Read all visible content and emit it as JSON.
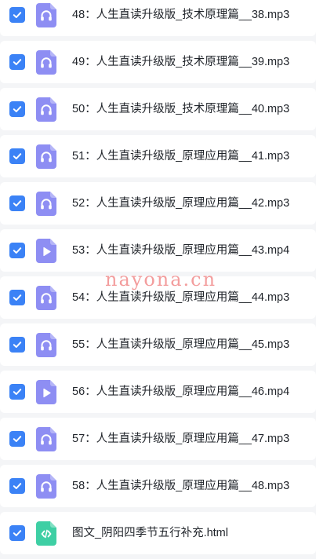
{
  "colors": {
    "checkbox": "#3b82f6",
    "audio_icon": "#8e8ef3",
    "video_icon": "#8e8ef3",
    "html_icon": "#3ecfa4",
    "row_background": "#ffffff",
    "page_background": "#f4f5f7",
    "watermark": "#f28c8c"
  },
  "watermark": "nayona.cn",
  "files": [
    {
      "name": "48：人生直读升级版_技术原理篇__38.mp3",
      "type": "audio",
      "icon": "headphones-icon",
      "checked": true
    },
    {
      "name": "49：人生直读升级版_技术原理篇__39.mp3",
      "type": "audio",
      "icon": "headphones-icon",
      "checked": true
    },
    {
      "name": "50：人生直读升级版_技术原理篇__40.mp3",
      "type": "audio",
      "icon": "headphones-icon",
      "checked": true
    },
    {
      "name": "51：人生直读升级版_原理应用篇__41.mp3",
      "type": "audio",
      "icon": "headphones-icon",
      "checked": true
    },
    {
      "name": "52：人生直读升级版_原理应用篇__42.mp3",
      "type": "audio",
      "icon": "headphones-icon",
      "checked": true
    },
    {
      "name": "53：人生直读升级版_原理应用篇__43.mp4",
      "type": "video",
      "icon": "play-icon",
      "checked": true
    },
    {
      "name": "54：人生直读升级版_原理应用篇__44.mp3",
      "type": "audio",
      "icon": "headphones-icon",
      "checked": true
    },
    {
      "name": "55：人生直读升级版_原理应用篇__45.mp3",
      "type": "audio",
      "icon": "headphones-icon",
      "checked": true
    },
    {
      "name": "56：人生直读升级版_原理应用篇__46.mp4",
      "type": "video",
      "icon": "play-icon",
      "checked": true
    },
    {
      "name": "57：人生直读升级版_原理应用篇__47.mp3",
      "type": "audio",
      "icon": "headphones-icon",
      "checked": true
    },
    {
      "name": "58：人生直读升级版_原理应用篇__48.mp3",
      "type": "audio",
      "icon": "headphones-icon",
      "checked": true
    },
    {
      "name": "图文_阴阳四季节五行补充.html",
      "type": "html",
      "icon": "code-icon",
      "checked": true
    }
  ]
}
